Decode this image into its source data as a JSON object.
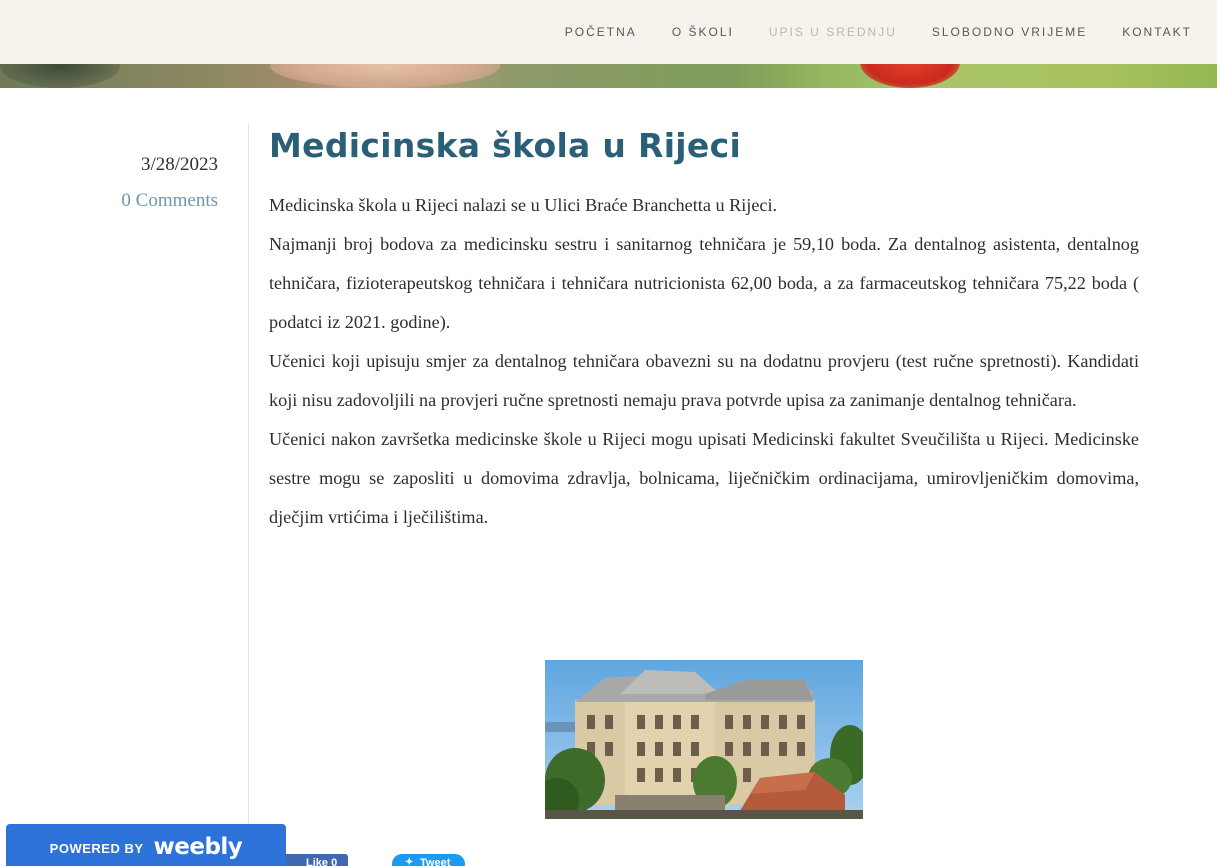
{
  "nav": {
    "items": [
      {
        "label": "POČETNA"
      },
      {
        "label": "O ŠKOLI"
      },
      {
        "label": "UPIS U SREDNJU"
      },
      {
        "label": "SLOBODNO VRIJEME"
      },
      {
        "label": "KONTAKT"
      }
    ]
  },
  "post": {
    "date": "3/28/2023",
    "comments": "0 Comments",
    "title": "Medicinska škola u Rijeci",
    "paragraphs": [
      "Medicinska škola u Rijeci nalazi se u Ulici Braće Branchetta u Rijeci.",
      "Najmanji broj bodova za medicinsku sestru i sanitarnog tehničara je 59,10 boda. Za dentalnog asistenta, dentalnog tehničara, fizioterapeutskog tehničara i tehničara nutricionista 62,00 boda, a za farmaceutskog tehničara 75,22 boda ( podatci iz 2021. godine).",
      "Učenici koji upisuju smjer za dentalnog tehničara obavezni su na dodatnu provjeru (test ručne spretnosti). Kandidati koji nisu zadovoljili na provjeri ručne spretnosti nemaju prava potvrde upisa za zanimanje dentalnog tehničara.",
      "Učenici nakon završetka medicinske škole u Rijeci mogu upisati Medicinski fakultet Sveučilišta u Rijeci. Medicinske sestre mogu se zaposliti u domovima zdravlja, bolnicama, liječničkim ordinacijama, umirovljeničkim domovima, dječjim vrtićima i lječilištima."
    ]
  },
  "social": {
    "like_label": "Like 0",
    "tweet_label": "Tweet"
  },
  "badge": {
    "powered_by": "POWERED BY",
    "brand": "weebly"
  }
}
